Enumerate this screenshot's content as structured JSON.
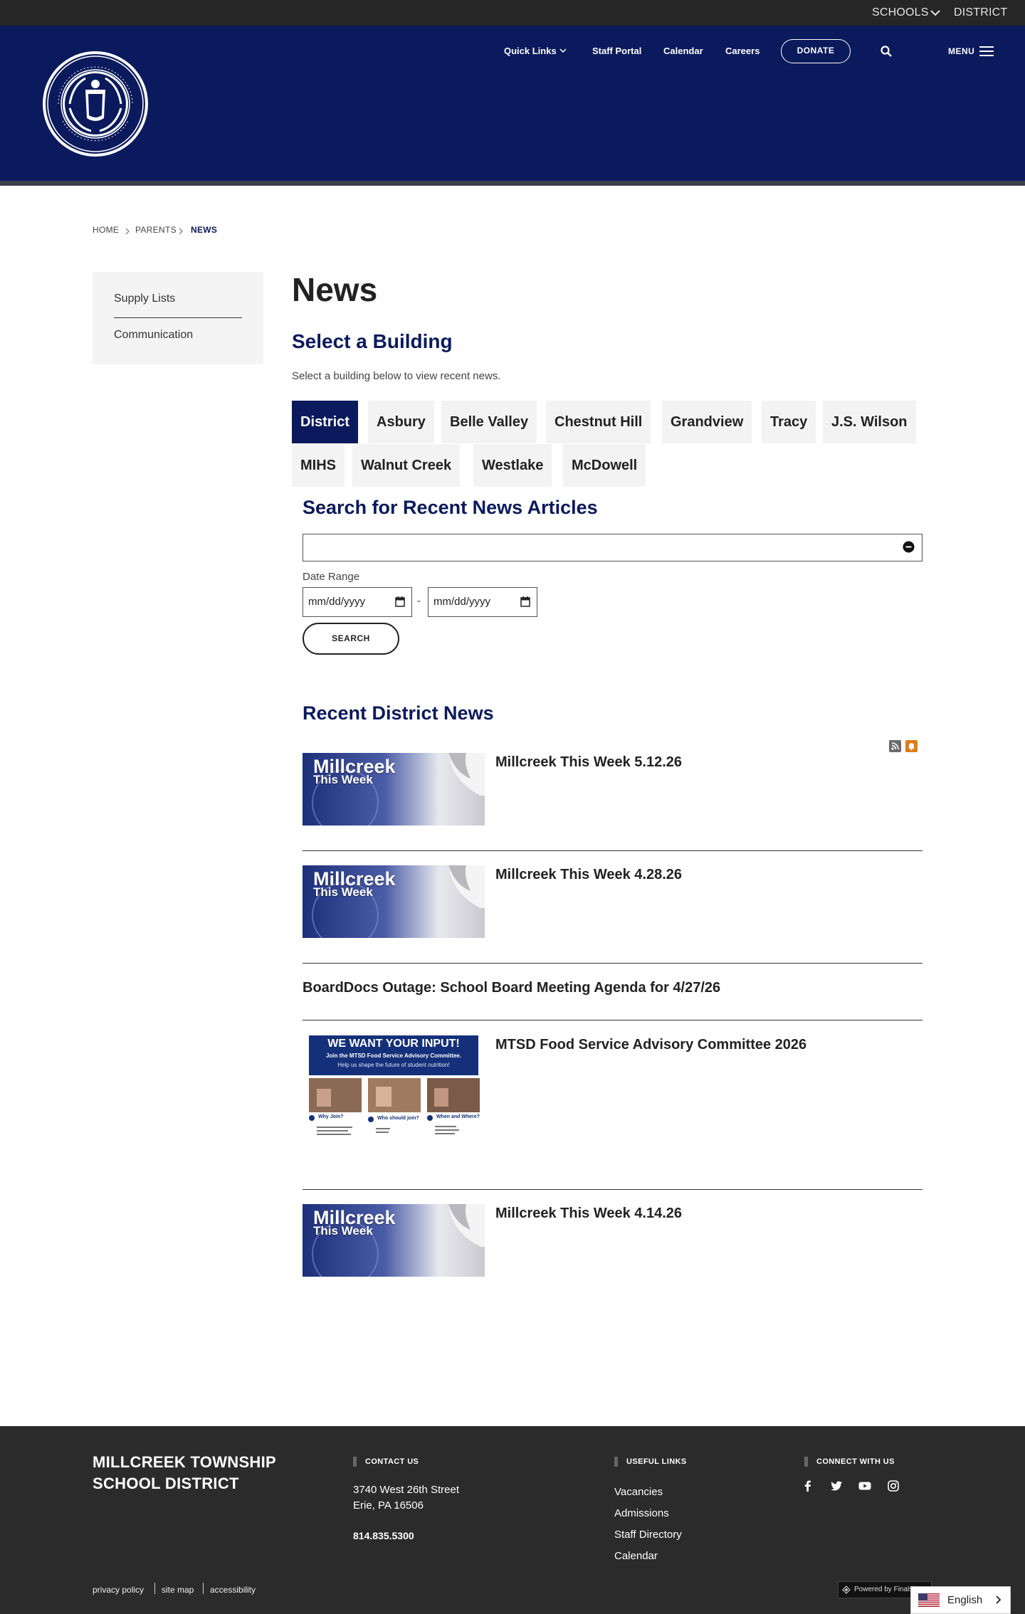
{
  "utility": {
    "schools": "SCHOOLS",
    "district": "DISTRICT"
  },
  "nav": {
    "quick_links": "Quick Links",
    "staff_portal": "Staff Portal",
    "calendar": "Calendar",
    "careers": "Careers",
    "donate": "DONATE",
    "menu": "MENU",
    "icons": [
      "seal-logo",
      "search-icon",
      "menu-icon",
      "chevron-down-icon"
    ]
  },
  "breadcrumb": {
    "home": "HOME",
    "parents": "PARENTS",
    "current": "NEWS"
  },
  "sidebar": {
    "items": [
      "Supply Lists",
      "Communication"
    ]
  },
  "main": {
    "title": "News",
    "select_heading": "Select a Building",
    "select_desc": "Select a building below to view recent news.",
    "buildings": [
      "District",
      "Asbury",
      "Belle Valley",
      "Chestnut Hill",
      "Grandview",
      "Tracy",
      "J.S. Wilson",
      "MIHS",
      "Walnut Creek",
      "Westlake",
      "McDowell"
    ],
    "active_building": "District",
    "search_heading": "Search for Recent News Articles",
    "search_value": "",
    "date_label": "Date Range",
    "date_placeholder": "mm/dd/yyyy",
    "date_sep": "-",
    "search_button": "SEARCH",
    "recent_heading": "Recent District News"
  },
  "articles": [
    {
      "title": "Millcreek This Week 5.12.26",
      "thumb": "Millcreek This Week"
    },
    {
      "title": "Millcreek This Week 4.28.26",
      "thumb": "Millcreek This Week"
    },
    {
      "title": "BoardDocs Outage: School Board Meeting Agenda for 4/27/26",
      "thumb": ""
    },
    {
      "title": "MTSD Food Service Advisory Committee 2026",
      "thumb": "WE WANT YOUR INPUT!"
    },
    {
      "title": "Millcreek This Week 4.14.26",
      "thumb": "Millcreek This Week"
    }
  ],
  "thumb_text": {
    "line1": "Millcreek",
    "line2": "This Week"
  },
  "flyer": {
    "headline": "WE WANT YOUR INPUT!",
    "sub1": "Join the MTSD Food Service Advisory Committee.",
    "sub2": "Help us shape the future of student nutrition!",
    "q1": "Why Join?",
    "q2": "Who should join?",
    "q3": "When and Where?"
  },
  "footer": {
    "district_line1": "MILLCREEK TOWNSHIP",
    "district_line2": "SCHOOL DISTRICT",
    "contact_head": "CONTACT US",
    "address1": "3740 West 26th Street",
    "address2": "Erie, PA  16506",
    "phone": "814.835.5300",
    "useful_head": "USEFUL LINKS",
    "useful_links": [
      "Vacancies",
      "Admissions",
      "Staff Directory",
      "Calendar"
    ],
    "connect_head": "CONNECT WITH US",
    "social": [
      "facebook-icon",
      "twitter-icon",
      "youtube-icon",
      "instagram-icon"
    ],
    "legal": [
      "privacy policy",
      "site map",
      "accessibility"
    ],
    "powered": "Powered by Finalsite"
  },
  "language": {
    "label": "English"
  },
  "colors": {
    "navy": "#0b1a5c",
    "utility_bar": "#262626",
    "footer": "#2b2b2b",
    "rss": "#6b6b6b",
    "notify": "#e07b16"
  }
}
